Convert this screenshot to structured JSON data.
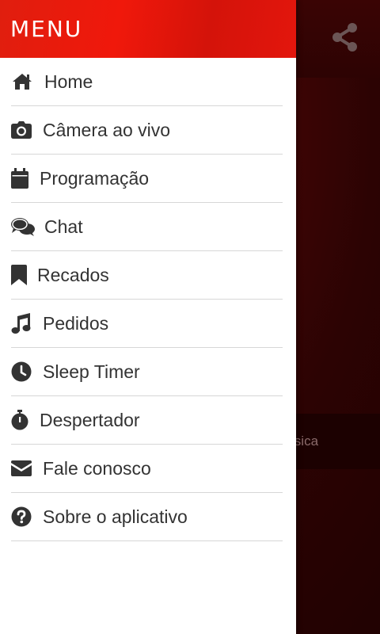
{
  "drawer": {
    "title": "MENU",
    "items": [
      {
        "label": "Home",
        "icon": "home-icon"
      },
      {
        "label": "Câmera ao vivo",
        "icon": "camera-icon"
      },
      {
        "label": "Programação",
        "icon": "calendar-icon"
      },
      {
        "label": "Chat",
        "icon": "chat-icon"
      },
      {
        "label": "Recados",
        "icon": "bookmark-icon"
      },
      {
        "label": "Pedidos",
        "icon": "music-note-icon"
      },
      {
        "label": "Sleep Timer",
        "icon": "clock-icon"
      },
      {
        "label": "Despertador",
        "icon": "stopwatch-icon"
      },
      {
        "label": "Fale conosco",
        "icon": "envelope-icon"
      },
      {
        "label": "Sobre o aplicativo",
        "icon": "question-circle-icon"
      }
    ]
  },
  "background": {
    "share_icon": "share-icon",
    "now_playing_fragment": "a música"
  },
  "colors": {
    "header_red": "#e01e0e",
    "text": "#333333",
    "divider": "#d7d7d7",
    "background_dark_red": "#2c0303"
  }
}
